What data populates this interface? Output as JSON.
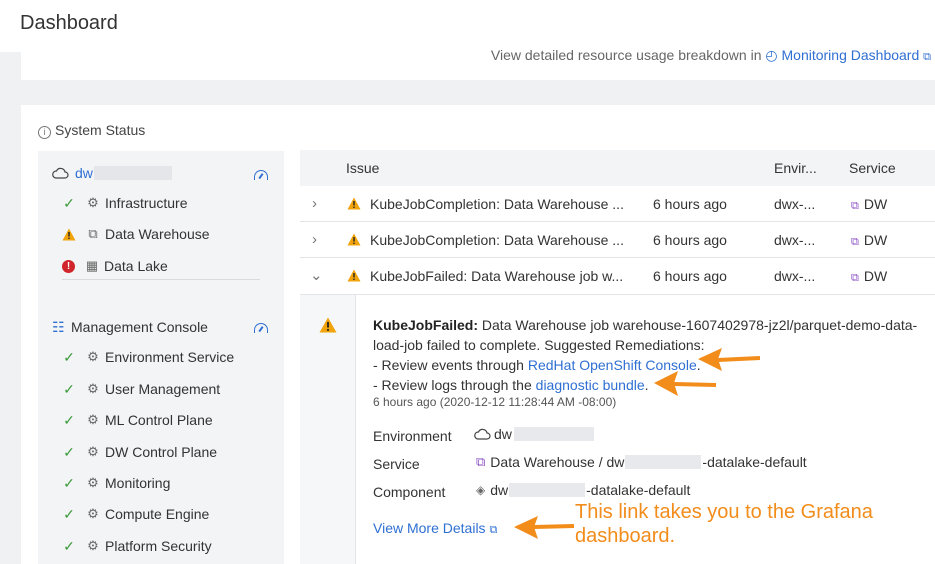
{
  "header": {
    "title": "Dashboard"
  },
  "top_card": {
    "prefix": "View detailed resource usage breakdown in",
    "link": "Monitoring Dashboard"
  },
  "system_status": {
    "title": "System Status",
    "environment": {
      "name": "dw"
    },
    "env_services": [
      {
        "label": "Infrastructure",
        "status": "ok"
      },
      {
        "label": "Data Warehouse",
        "status": "warning"
      },
      {
        "label": "Data Lake",
        "status": "error"
      }
    ],
    "management_console": {
      "label": "Management Console"
    },
    "mc_services": [
      {
        "label": "Environment Service",
        "status": "ok"
      },
      {
        "label": "User Management",
        "status": "ok"
      },
      {
        "label": "ML Control Plane",
        "status": "ok"
      },
      {
        "label": "DW Control Plane",
        "status": "ok"
      },
      {
        "label": "Monitoring",
        "status": "ok"
      },
      {
        "label": "Compute Engine",
        "status": "ok"
      },
      {
        "label": "Platform Security",
        "status": "ok"
      }
    ]
  },
  "table": {
    "headers": {
      "issue": "Issue",
      "environment": "Envir...",
      "service": "Service"
    },
    "rows": [
      {
        "issue": "KubeJobCompletion: Data Warehouse ...",
        "time": "6 hours ago",
        "env": "dwx-...",
        "service": "DW",
        "expanded": false
      },
      {
        "issue": "KubeJobCompletion: Data Warehouse ...",
        "time": "6 hours ago",
        "env": "dwx-...",
        "service": "DW",
        "expanded": false
      },
      {
        "issue": "KubeJobFailed: Data Warehouse job w...",
        "time": "6 hours ago",
        "env": "dwx-...",
        "service": "DW",
        "expanded": true
      }
    ],
    "detail": {
      "title": "KubeJobFailed:",
      "message": "Data Warehouse job warehouse-1607402978-jz2l/parquet-demo-data-load-job failed to complete. Suggested Remediations:",
      "line1_prefix": "- Review events through",
      "line1_link": "RedHat OpenShift Console",
      "line1_suffix": ".",
      "line2_prefix": "- Review logs through the",
      "line2_link": "diagnostic bundle",
      "line2_suffix": ".",
      "timestamp": "6 hours ago (2020-12-12 11:28:44 AM -08:00)",
      "environment_label": "Environment",
      "environment_value": "dw",
      "service_label": "Service",
      "service_value_a": "Data Warehouse / dw",
      "service_value_b": "-datalake-default",
      "component_label": "Component",
      "component_value_a": "dw",
      "component_value_b": "-datalake-default",
      "more_link": "View More Details"
    }
  },
  "annotation": {
    "line1": "This link takes you to the Grafana",
    "line2": "dashboard."
  },
  "colors": {
    "link": "#2f6fd2",
    "ok": "#3b9a3b",
    "warning": "#f0a30a",
    "error": "#d0262b",
    "annotation": "#f28c1a"
  }
}
